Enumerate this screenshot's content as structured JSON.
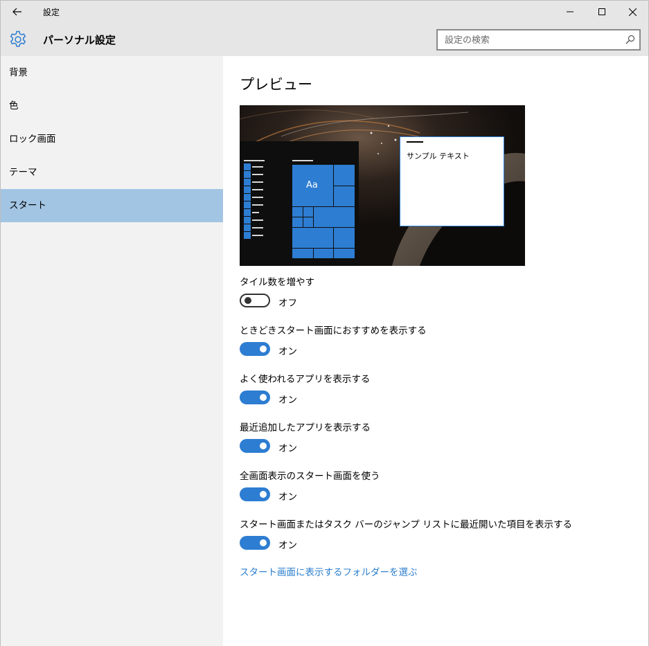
{
  "window": {
    "title": "設定"
  },
  "header": {
    "title": "パーソナル設定"
  },
  "search": {
    "placeholder": "設定の検索"
  },
  "sidebar": {
    "items": [
      {
        "label": "背景"
      },
      {
        "label": "色"
      },
      {
        "label": "ロック画面"
      },
      {
        "label": "テーマ"
      },
      {
        "label": "スタート"
      }
    ],
    "active_index": 4
  },
  "main": {
    "title": "プレビュー",
    "preview": {
      "tile_label": "Aa",
      "sample_text": "サンプル テキスト"
    },
    "settings": [
      {
        "label": "タイル数を増やす",
        "state": "オフ",
        "on": false
      },
      {
        "label": "ときどきスタート画面におすすめを表示する",
        "state": "オン",
        "on": true
      },
      {
        "label": "よく使われるアプリを表示する",
        "state": "オン",
        "on": true
      },
      {
        "label": "最近追加したアプリを表示する",
        "state": "オン",
        "on": true
      },
      {
        "label": "全画面表示のスタート画面を使う",
        "state": "オン",
        "on": true
      },
      {
        "label": "スタート画面またはタスク バーのジャンプ リストに最近開いた項目を表示する",
        "state": "オン",
        "on": true
      }
    ],
    "folder_link": "スタート画面に表示するフォルダーを選ぶ"
  },
  "colors": {
    "accent": "#2d7dd2",
    "sidebar_active": "#a3c5e4",
    "link": "#2c7fcf"
  }
}
